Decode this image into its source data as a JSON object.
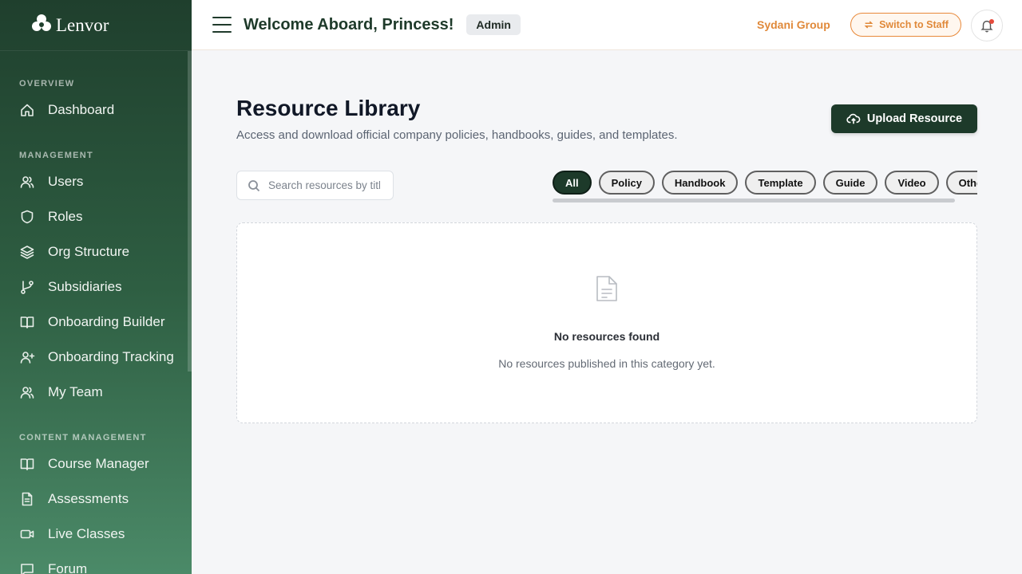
{
  "brand": {
    "name": "Lenvor"
  },
  "sidebar": {
    "sections": [
      {
        "label": "OVERVIEW",
        "items": [
          {
            "label": "Dashboard",
            "icon": "home-icon"
          }
        ]
      },
      {
        "label": "MANAGEMENT",
        "items": [
          {
            "label": "Users",
            "icon": "users-icon"
          },
          {
            "label": "Roles",
            "icon": "shield-icon"
          },
          {
            "label": "Org Structure",
            "icon": "layers-icon"
          },
          {
            "label": "Subsidiaries",
            "icon": "git-branch-icon"
          },
          {
            "label": "Onboarding Builder",
            "icon": "book-open-icon"
          },
          {
            "label": "Onboarding Tracking",
            "icon": "user-plus-icon"
          },
          {
            "label": "My Team",
            "icon": "users-icon"
          }
        ]
      },
      {
        "label": "CONTENT MANAGEMENT",
        "items": [
          {
            "label": "Course Manager",
            "icon": "book-open-icon"
          },
          {
            "label": "Assessments",
            "icon": "file-text-icon"
          },
          {
            "label": "Live Classes",
            "icon": "video-icon"
          },
          {
            "label": "Forum",
            "icon": "message-square-icon"
          }
        ]
      }
    ]
  },
  "header": {
    "welcome": "Welcome Aboard, Princess!",
    "role": "Admin",
    "company": "Sydani Group",
    "switch_label": "Switch to Staff"
  },
  "main": {
    "title": "Resource Library",
    "subtitle": "Access and download official company policies, handbooks, guides, and templates.",
    "upload_label": "Upload Resource",
    "search_placeholder": "Search resources by title...",
    "search_value": "",
    "filters": [
      "All",
      "Policy",
      "Handbook",
      "Template",
      "Guide",
      "Video",
      "Other"
    ],
    "active_filter": "All",
    "empty_title": "No resources found",
    "empty_sub": "No resources published in this category yet."
  },
  "colors": {
    "sidebar_top": "#1f3f2d",
    "sidebar_bottom": "#4b8a68",
    "primary": "#1d3a2a",
    "accent": "#e0893a",
    "notification_dot": "#e54b3c"
  }
}
